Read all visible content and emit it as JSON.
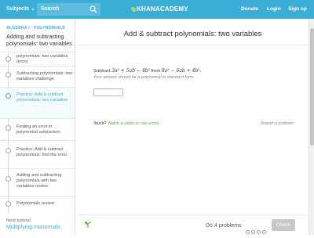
{
  "topbar": {
    "subjects_label": "Subjects",
    "subjects_caret": "⌄",
    "search_placeholder": "Search",
    "logo_text": "KHANACADEMY",
    "donate": "Donate",
    "login": "Login",
    "signup": "Sign up"
  },
  "sidebar": {
    "breadcrumb": "ALGEBRA I · POLYNOMIALS",
    "tutorial_title": "Adding and subtracting polynomials: two variables",
    "steps": [
      {
        "label": "polynomials: two variables (intro)"
      },
      {
        "label": "Subtracting polynomials: two variables challenge"
      },
      {
        "label": "Practice: Add & subtract polynomials: two variables"
      },
      {
        "label": "Finding an error in polynomial subtraction"
      },
      {
        "label": "Practice: Add & subtract polynomials: find the error"
      },
      {
        "label": "Adding and subtracting polynomials with two variables review"
      },
      {
        "label": "Polynomials review"
      }
    ],
    "next_label": "Next tutorial",
    "next_title": "Multiplying monomials"
  },
  "exercise": {
    "title": "Add & subtract polynomials: two variables",
    "prompt_word": "Subtract",
    "expr1": "3a² + 5ab − 4b²",
    "from_word": "from",
    "expr2": "8a² − 6ab + 4b².",
    "note": "Your answer should be a polynomial in standard form.",
    "stuck_label": "Stuck?",
    "stuck_link": "Watch a video or use a hint.",
    "report": "Report a problem"
  },
  "footer": {
    "count_text": "Do 4 problems",
    "check_label": "Check"
  },
  "colors": {
    "brand_blue": "#3aaed6",
    "link_green": "#5aac3a",
    "disabled_gray": "#c8c8c8"
  },
  "icons": [
    "search-icon",
    "khan-leaf-logo",
    "sprout-icon",
    "chevron-down-icon"
  ]
}
